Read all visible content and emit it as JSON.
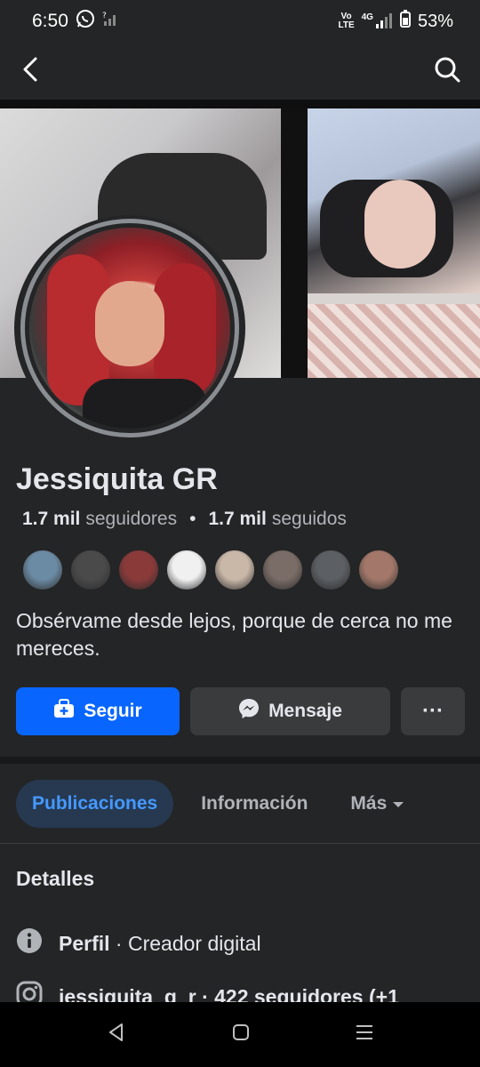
{
  "status_bar": {
    "time": "6:50",
    "network_label_top": "Vo",
    "network_label_bottom": "LTE",
    "network_type": "4G",
    "battery": "53%"
  },
  "profile": {
    "name": "Jessiquita GR",
    "followers_count": "1.7 mil",
    "followers_label": "seguidores",
    "following_count": "1.7 mil",
    "following_label": "seguidos",
    "bio": "Obsérvame desde lejos, porque de cerca no me mereces."
  },
  "actions": {
    "follow_label": "Seguir",
    "message_label": "Mensaje",
    "more_label": "···"
  },
  "tabs": [
    {
      "label": "Publicaciones"
    },
    {
      "label": "Información"
    },
    {
      "label": "Más"
    }
  ],
  "details": {
    "title": "Detalles",
    "rows": [
      {
        "bold": "Perfil",
        "text": " · Creador digital",
        "icon": "info-icon"
      },
      {
        "bold": "jessiquita_g_r",
        "text": " · 422 seguidores (+1",
        "icon": "instagram-icon"
      }
    ]
  },
  "friend_avatars": [
    "#6b8aa3",
    "#4a4a4a",
    "#8b3a3a",
    "#f0f0f0",
    "#c9b7a8",
    "#7a6c66",
    "#5c5f63",
    "#a3786a"
  ],
  "colors": {
    "primary": "#0866ff",
    "background": "#242526",
    "secondary_button": "#3a3b3c",
    "active_tab_bg": "#263951",
    "active_tab_text": "#4599ff"
  }
}
